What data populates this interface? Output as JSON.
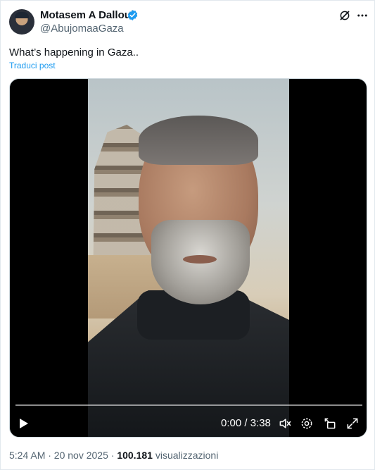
{
  "post": {
    "author_name": "Motasem A Dalloul",
    "author_handle": "@AbujomaaGaza",
    "text": "What’s happening in Gaza..",
    "translate_label": "Traduci post"
  },
  "video": {
    "time_display": "0:00 / 3:38",
    "progress": 0
  },
  "meta": {
    "time_date": "5:24 AM · 20 nov 2025 · ",
    "views_count": "100.181",
    "views_label": " visualizzazioni"
  },
  "colors": {
    "link": "#1d9bf0",
    "verified": "#1d9bf0",
    "secondary_text": "#536471"
  },
  "icons": [
    "verified-badge-icon",
    "grok-icon",
    "more-icon",
    "play-icon",
    "mute-icon",
    "settings-icon",
    "pip-icon",
    "fullscreen-icon"
  ]
}
